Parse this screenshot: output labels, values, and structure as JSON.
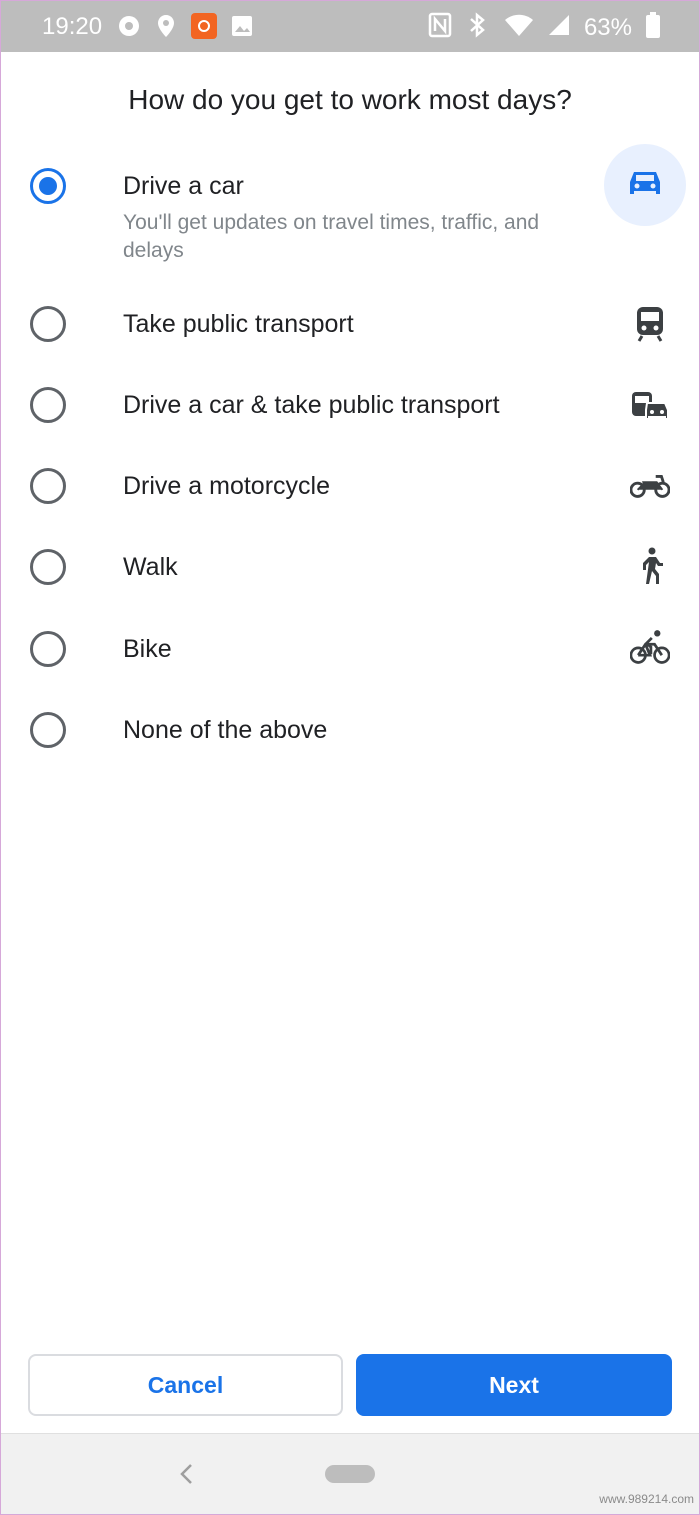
{
  "status_bar": {
    "time": "19:20",
    "icons_left": [
      "record-icon",
      "location-icon",
      "app-notification-icon",
      "image-icon"
    ],
    "icons_right": [
      "nfc-icon",
      "bluetooth-icon",
      "wifi-icon",
      "cell-signal-icon",
      "battery-icon"
    ],
    "battery_percent": "63%"
  },
  "question": "How do you get to work most days?",
  "options": [
    {
      "label": "Drive a car",
      "subtitle": "You'll get updates on travel times, traffic, and delays",
      "icon": "car-icon",
      "selected": true
    },
    {
      "label": "Take public transport",
      "icon": "train-icon",
      "selected": false
    },
    {
      "label": "Drive a car & take public transport",
      "icon": "car-and-bus-icon",
      "selected": false
    },
    {
      "label": "Drive a motorcycle",
      "icon": "motorcycle-icon",
      "selected": false
    },
    {
      "label": "Walk",
      "icon": "walk-icon",
      "selected": false
    },
    {
      "label": "Bike",
      "icon": "bike-icon",
      "selected": false
    },
    {
      "label": "None of the above",
      "icon": "",
      "selected": false
    }
  ],
  "buttons": {
    "cancel": "Cancel",
    "next": "Next"
  },
  "colors": {
    "accent": "#1a73e8",
    "selected_icon_bg": "#e8f0fe",
    "status_bar_bg": "#bdbdbd"
  },
  "watermark": "www.989214.com"
}
